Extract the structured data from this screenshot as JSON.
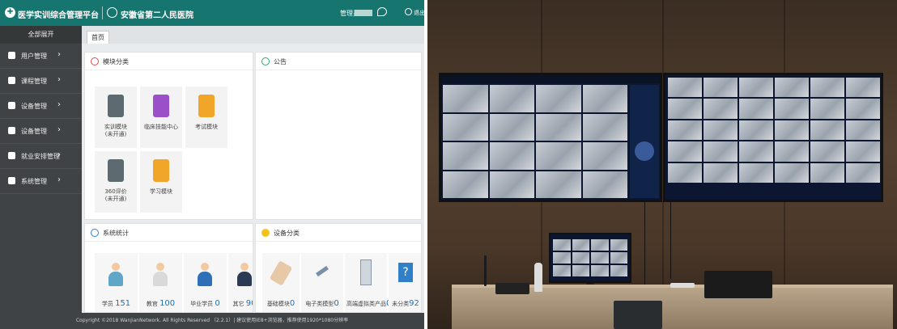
{
  "app": {
    "platform_title": "医学实训综合管理平台",
    "hospital_name": "安徽省第二人民医院",
    "user_label": "管理员",
    "logout_label": "退出",
    "sidebar": {
      "expand_all": "全部展开",
      "items": [
        {
          "label": "用户管理",
          "icon": "user-icon"
        },
        {
          "label": "课程管理",
          "icon": "grid-icon"
        },
        {
          "label": "设备管理",
          "icon": "device-icon"
        },
        {
          "label": "设备管理",
          "icon": "settings-icon"
        },
        {
          "label": "就业安排管理",
          "icon": "doc-icon"
        },
        {
          "label": "系统管理",
          "icon": "search-icon"
        }
      ]
    },
    "tabs": [
      "首页"
    ],
    "panels": {
      "modules": {
        "title": "模块分类",
        "tiles": [
          {
            "label": "实训模块\n(未开通)",
            "color": "#5d6a70",
            "icon": "hospital-icon"
          },
          {
            "label": "临床技能中心",
            "color": "#9b4fc9",
            "icon": "book-icon"
          },
          {
            "label": "考试模块",
            "color": "#f2a629",
            "icon": "pencil-icon"
          },
          {
            "label": "360评价\n(未开通)",
            "color": "#5d6a70",
            "icon": "chat-icon"
          },
          {
            "label": "学习模块",
            "color": "#f2a629",
            "icon": "edit-icon"
          }
        ]
      },
      "notice": {
        "title": "公告"
      },
      "stats": {
        "title": "系统统计",
        "items": [
          {
            "label": "学员",
            "count": "151",
            "color": "#5fa6c9"
          },
          {
            "label": "教官",
            "count": "100",
            "color": "#e9e9e9"
          },
          {
            "label": "毕业学员",
            "count": "0",
            "color": "#2f6fb8"
          },
          {
            "label": "其它",
            "count": "90",
            "color": "#2b3b55"
          }
        ]
      },
      "devices": {
        "title": "设备分类",
        "items": [
          {
            "label": "基础模块",
            "count": "0",
            "icon": "arm-icon"
          },
          {
            "label": "电子类模型",
            "count": "0",
            "icon": "syringe-icon"
          },
          {
            "label": "高端虚拟类产品",
            "count": "0",
            "icon": "monitor-icon"
          },
          {
            "label": "未分类",
            "count": "92",
            "icon": "question-icon"
          }
        ]
      }
    },
    "footer": "Copyright ©2018 WanjianNetwork. All Rights Reserved （2.2.1）| 建议使用IE8+浏览器，推荐使用1920*1080分辨率"
  },
  "photo": {
    "description_icon": "control-room-photo"
  },
  "colors": {
    "topbar": "#16756f",
    "sidebar": "#3f4345",
    "accent_red": "#e04848",
    "accent_green": "#2fa36c",
    "accent_blue": "#2f80c8",
    "accent_yellow": "#f2c21b"
  }
}
